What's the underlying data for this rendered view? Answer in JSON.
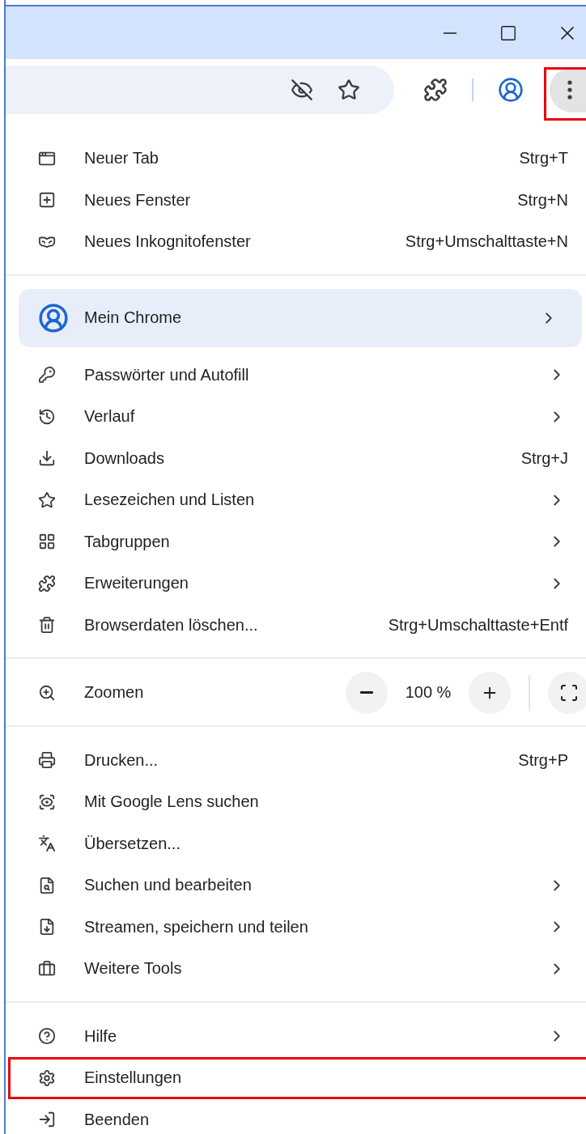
{
  "window_controls": {
    "highlighted_menu_button": true
  },
  "menu": {
    "groups": [
      {
        "items": [
          {
            "kind": "item",
            "label": "Neuer Tab",
            "shortcut": "Strg+T",
            "submenu": false,
            "highlighted": false
          },
          {
            "kind": "item",
            "label": "Neues Fenster",
            "shortcut": "Strg+N",
            "submenu": false,
            "highlighted": false
          },
          {
            "kind": "item",
            "label": "Neues Inkognitofenster",
            "shortcut": "Strg+Umschalttaste+N",
            "submenu": false,
            "highlighted": false
          }
        ]
      },
      {
        "items": [
          {
            "kind": "profile",
            "label": "Mein Chrome",
            "submenu": true,
            "highlighted": false
          },
          {
            "kind": "item",
            "label": "Passwörter und Autofill",
            "submenu": true,
            "highlighted": false
          },
          {
            "kind": "item",
            "label": "Verlauf",
            "submenu": true,
            "highlighted": false
          },
          {
            "kind": "item",
            "label": "Downloads",
            "shortcut": "Strg+J",
            "submenu": false,
            "highlighted": false
          },
          {
            "kind": "item",
            "label": "Lesezeichen und Listen",
            "submenu": true,
            "highlighted": false
          },
          {
            "kind": "item",
            "label": "Tabgruppen",
            "submenu": true,
            "highlighted": false
          },
          {
            "kind": "item",
            "label": "Erweiterungen",
            "submenu": true,
            "highlighted": false
          },
          {
            "kind": "item",
            "label": "Browserdaten löschen...",
            "shortcut": "Strg+Umschalttaste+Entf",
            "submenu": false,
            "highlighted": false
          }
        ]
      },
      {
        "items": [
          {
            "kind": "zoom",
            "label": "Zoomen",
            "value": "100 %"
          }
        ]
      },
      {
        "items": [
          {
            "kind": "item",
            "label": "Drucken...",
            "shortcut": "Strg+P",
            "submenu": false,
            "highlighted": false
          },
          {
            "kind": "item",
            "label": "Mit Google Lens suchen",
            "submenu": false,
            "highlighted": false
          },
          {
            "kind": "item",
            "label": "Übersetzen...",
            "submenu": false,
            "highlighted": false
          },
          {
            "kind": "item",
            "label": "Suchen und bearbeiten",
            "submenu": true,
            "highlighted": false
          },
          {
            "kind": "item",
            "label": "Streamen, speichern und teilen",
            "submenu": true,
            "highlighted": false
          },
          {
            "kind": "item",
            "label": "Weitere Tools",
            "submenu": true,
            "highlighted": false
          }
        ]
      },
      {
        "items": [
          {
            "kind": "item",
            "label": "Hilfe",
            "submenu": true,
            "highlighted": false
          },
          {
            "kind": "item",
            "label": "Einstellungen",
            "submenu": false,
            "highlighted": true
          },
          {
            "kind": "item",
            "label": "Beenden",
            "submenu": false,
            "highlighted": false
          }
        ]
      }
    ]
  }
}
